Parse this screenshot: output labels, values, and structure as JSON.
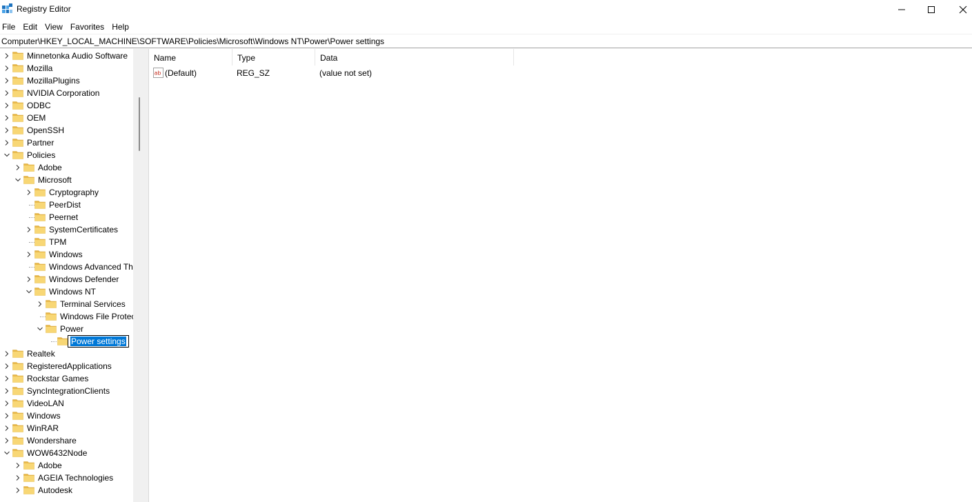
{
  "window": {
    "title": "Registry Editor",
    "minimize_glyph": "—",
    "maximize_glyph": "☐",
    "close_glyph": "✕"
  },
  "menu": [
    "File",
    "Edit",
    "View",
    "Favorites",
    "Help"
  ],
  "address": "Computer\\HKEY_LOCAL_MACHINE\\SOFTWARE\\Policies\\Microsoft\\Windows NT\\Power\\Power settings",
  "tree": {
    "items": [
      {
        "label": "Minnetonka Audio Software",
        "depth": 0,
        "expander": "right"
      },
      {
        "label": "Mozilla",
        "depth": 0,
        "expander": "right"
      },
      {
        "label": "MozillaPlugins",
        "depth": 0,
        "expander": "right"
      },
      {
        "label": "NVIDIA Corporation",
        "depth": 0,
        "expander": "right"
      },
      {
        "label": "ODBC",
        "depth": 0,
        "expander": "right"
      },
      {
        "label": "OEM",
        "depth": 0,
        "expander": "right"
      },
      {
        "label": "OpenSSH",
        "depth": 0,
        "expander": "right"
      },
      {
        "label": "Partner",
        "depth": 0,
        "expander": "right"
      },
      {
        "label": "Policies",
        "depth": 0,
        "expander": "down"
      },
      {
        "label": "Adobe",
        "depth": 1,
        "expander": "right"
      },
      {
        "label": "Microsoft",
        "depth": 1,
        "expander": "down"
      },
      {
        "label": "Cryptography",
        "depth": 2,
        "expander": "right"
      },
      {
        "label": "PeerDist",
        "depth": 2,
        "expander": "none"
      },
      {
        "label": "Peernet",
        "depth": 2,
        "expander": "none"
      },
      {
        "label": "SystemCertificates",
        "depth": 2,
        "expander": "right"
      },
      {
        "label": "TPM",
        "depth": 2,
        "expander": "none"
      },
      {
        "label": "Windows",
        "depth": 2,
        "expander": "right"
      },
      {
        "label": "Windows Advanced Thre",
        "depth": 2,
        "expander": "none"
      },
      {
        "label": "Windows Defender",
        "depth": 2,
        "expander": "right"
      },
      {
        "label": "Windows NT",
        "depth": 2,
        "expander": "down"
      },
      {
        "label": "Terminal Services",
        "depth": 3,
        "expander": "right"
      },
      {
        "label": "Windows File Protecti",
        "depth": 3,
        "expander": "none"
      },
      {
        "label": "Power",
        "depth": 3,
        "expander": "down"
      },
      {
        "label": "Power settings",
        "depth": 4,
        "expander": "none",
        "editing": true
      },
      {
        "label": "Realtek",
        "depth": 0,
        "expander": "right"
      },
      {
        "label": "RegisteredApplications",
        "depth": 0,
        "expander": "right"
      },
      {
        "label": "Rockstar Games",
        "depth": 0,
        "expander": "right"
      },
      {
        "label": "SyncIntegrationClients",
        "depth": 0,
        "expander": "right"
      },
      {
        "label": "VideoLAN",
        "depth": 0,
        "expander": "right"
      },
      {
        "label": "Windows",
        "depth": 0,
        "expander": "right"
      },
      {
        "label": "WinRAR",
        "depth": 0,
        "expander": "right"
      },
      {
        "label": "Wondershare",
        "depth": 0,
        "expander": "right"
      },
      {
        "label": "WOW6432Node",
        "depth": 0,
        "expander": "down"
      },
      {
        "label": "Adobe",
        "depth": 1,
        "expander": "right"
      },
      {
        "label": "AGEIA Technologies",
        "depth": 1,
        "expander": "right"
      },
      {
        "label": "Autodesk",
        "depth": 1,
        "expander": "right"
      }
    ]
  },
  "list": {
    "columns": [
      "Name",
      "Type",
      "Data"
    ],
    "rows": [
      {
        "icon": "string-value-icon",
        "name": "(Default)",
        "type": "REG_SZ",
        "data": "(value not set)"
      }
    ]
  },
  "colors": {
    "folder": "#f8d775",
    "folder_dark": "#e8b84a",
    "selection": "#0078d7",
    "icon_blue": "#1e73be"
  }
}
